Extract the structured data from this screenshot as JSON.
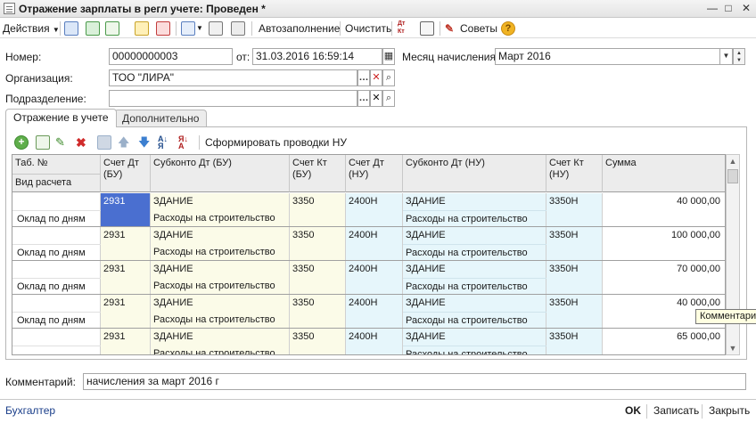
{
  "window": {
    "title": "Отражение зарплаты в регл учете: Проведен *",
    "minimize": "—",
    "maximize": "□",
    "close": "✕"
  },
  "toolbar": {
    "actions_label": "Действия",
    "autofill_label": "Автозаполнение",
    "clear_label": "Очистить",
    "dtkt_label": "Дт\nКт",
    "tips_label": "Советы"
  },
  "form": {
    "number_label": "Номер:",
    "number_value": "00000000003",
    "from_label": "от:",
    "date_value": "31.03.2016 16:59:14",
    "month_label": "Месяц начисления:",
    "month_value": "Март 2016",
    "org_label": "Организация:",
    "org_value": "ТОО \"ЛИРА\"",
    "dept_label": "Подразделение:",
    "dept_value": ""
  },
  "tabs": [
    {
      "label": "Отражение в учете"
    },
    {
      "label": "Дополнительно"
    }
  ],
  "grid_toolbar": {
    "generate_label": "Сформировать проводки НУ"
  },
  "grid": {
    "columns": {
      "tab_no": "Таб. №",
      "calc_type": "Вид расчета",
      "acc_dt_bu": "Счет Дт (БУ)",
      "subconto_dt_bu": "Субконто Дт (БУ)",
      "acc_kt_bu": "Счет Кт (БУ)",
      "acc_dt_nu": "Счет Дт (НУ)",
      "subconto_dt_nu": "Субконто Дт (НУ)",
      "acc_kt_nu": "Счет Кт (НУ)",
      "sum": "Сумма"
    },
    "rows": [
      {
        "tab_no": "",
        "calc_type": "Оклад по дням",
        "acc_dt_bu": "2931",
        "sub_bu_1": "ЗДАНИЕ",
        "sub_bu_2": "Расходы на строительство",
        "acc_kt_bu": "3350",
        "acc_dt_nu": "2400Н",
        "sub_nu_1": "ЗДАНИЕ",
        "sub_nu_2": "Расходы на строительство",
        "acc_kt_nu": "3350Н",
        "sum": "40 000,00"
      },
      {
        "tab_no": "",
        "calc_type": "Оклад по дням",
        "acc_dt_bu": "2931",
        "sub_bu_1": "ЗДАНИЕ",
        "sub_bu_2": "Расходы на строительство",
        "acc_kt_bu": "3350",
        "acc_dt_nu": "2400Н",
        "sub_nu_1": "ЗДАНИЕ",
        "sub_nu_2": "Расходы на строительство",
        "acc_kt_nu": "3350Н",
        "sum": "100 000,00"
      },
      {
        "tab_no": "",
        "calc_type": "Оклад по дням",
        "acc_dt_bu": "2931",
        "sub_bu_1": "ЗДАНИЕ",
        "sub_bu_2": "Расходы на строительство",
        "acc_kt_bu": "3350",
        "acc_dt_nu": "2400Н",
        "sub_nu_1": "ЗДАНИЕ",
        "sub_nu_2": "Расходы на строительство",
        "acc_kt_nu": "3350Н",
        "sum": "70 000,00"
      },
      {
        "tab_no": "",
        "calc_type": "Оклад по дням",
        "acc_dt_bu": "2931",
        "sub_bu_1": "ЗДАНИЕ",
        "sub_bu_2": "Расходы на строительство",
        "acc_kt_bu": "3350",
        "acc_dt_nu": "2400Н",
        "sub_nu_1": "ЗДАНИЕ",
        "sub_nu_2": "Расходы на строительство",
        "acc_kt_nu": "3350Н",
        "sum": "40 000,00"
      },
      {
        "tab_no": "",
        "calc_type": "",
        "acc_dt_bu": "2931",
        "sub_bu_1": "ЗДАНИЕ",
        "sub_bu_2": "Расходы на строительство",
        "acc_kt_bu": "3350",
        "acc_dt_nu": "2400Н",
        "sub_nu_1": "ЗДАНИЕ",
        "sub_nu_2": "Расходы на строительство",
        "acc_kt_nu": "3350Н",
        "sum": "65 000,00"
      }
    ]
  },
  "tooltip": "Комментарий",
  "comment": {
    "label": "Комментарий:",
    "value": "начисления за март 2016 г"
  },
  "bottom": {
    "accountant_link": "Бухгалтер",
    "ok_label": "OK",
    "save_label": "Записать",
    "close_label": "Закрыть"
  },
  "colors": {
    "bu_col_bg": "#fbfbe8",
    "nu_col_bg": "#e6f6fb",
    "selected_cell_bg": "#4a6fd0",
    "link": "#1a3e8a"
  }
}
